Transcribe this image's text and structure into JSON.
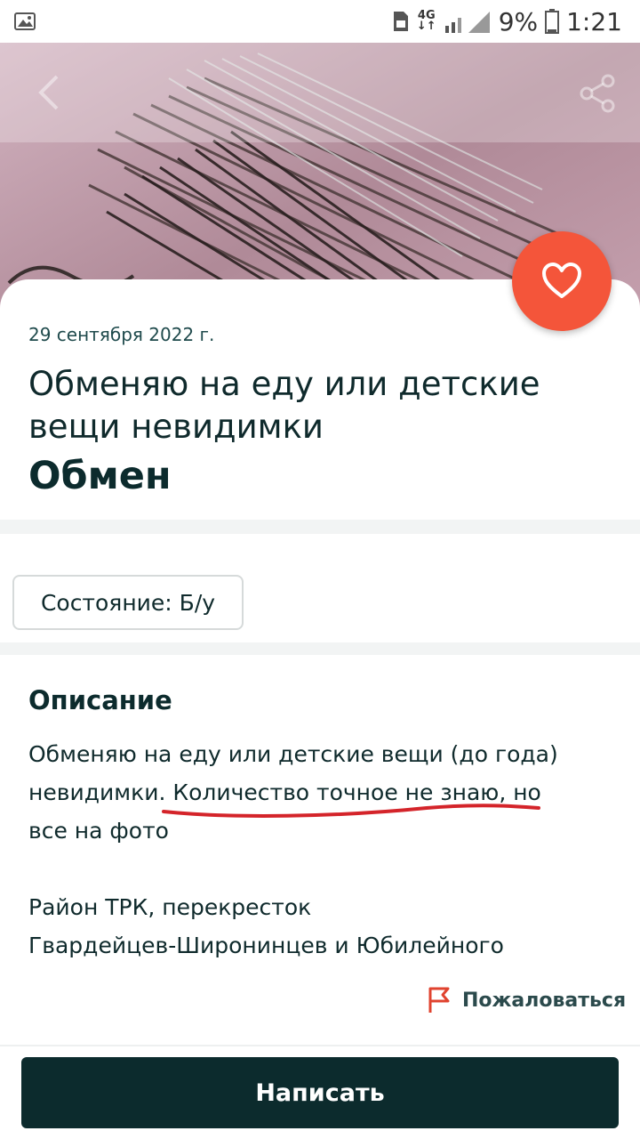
{
  "status_bar": {
    "network": "4G",
    "battery_percent": "9%",
    "time": "1:21"
  },
  "listing": {
    "date": "29 сентября 2022 г.",
    "title": "Обменяю на еду или детские вещи невидимки",
    "price": "Обмен",
    "condition": "Состояние: Б/у",
    "favorite_icon": "heart-icon"
  },
  "description": {
    "heading": "Описание",
    "lines": [
      "Обменяю на еду или детские вещи (до года)",
      "невидимки. Количество точное не знаю, но",
      "все на фото",
      "Район ТРК, перекресток",
      "Гвардейцев-Широнинцев и Юбилейного"
    ]
  },
  "actions": {
    "report_label": "Пожаловаться",
    "write_label": "Написать"
  },
  "colors": {
    "accent": "#f4553a",
    "primary_dark": "#0c2b2d",
    "annotation_red": "#d4242a"
  }
}
